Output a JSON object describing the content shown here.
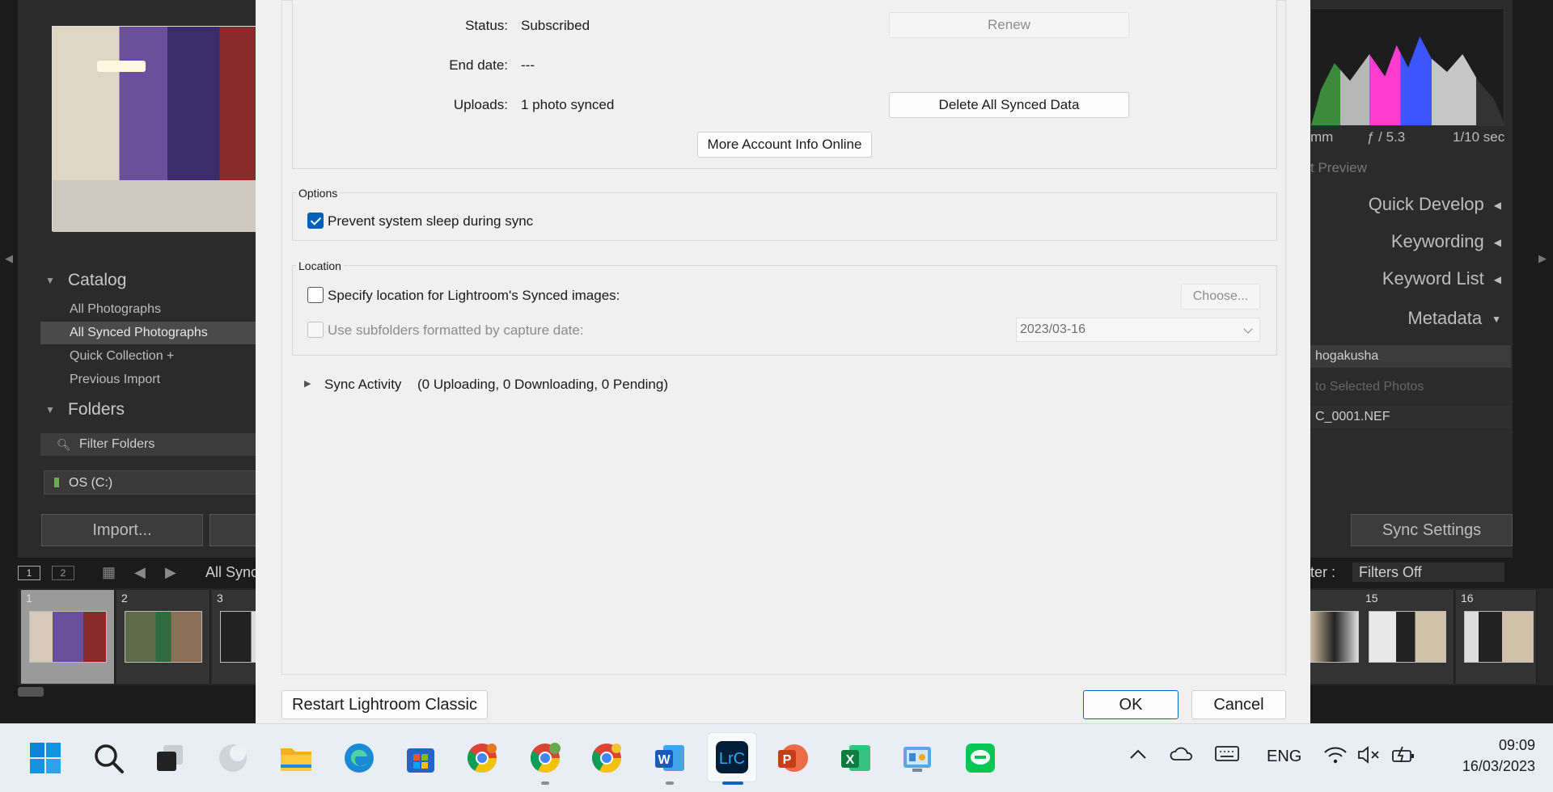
{
  "lightroom": {
    "catalog_heading": "Catalog",
    "catalog_items": [
      "All Photographs",
      "All Synced Photographs",
      "Quick Collection  +",
      "Previous Import"
    ],
    "folders_heading": "Folders",
    "filter_folders_placeholder": "Filter Folders",
    "volume": "OS (C:)",
    "import_button": "Import...",
    "exif": {
      "focal": "mm",
      "aperture": "ƒ / 5.3",
      "shutter": "1/10 sec"
    },
    "preview_label": "t Preview",
    "right_panels": [
      "Quick Develop",
      "Keywording",
      "Keyword List",
      "Metadata"
    ],
    "metadata_preset": "hogakusha",
    "metadata_target": "to      Selected Photos",
    "metadata_filename": "C_0001.NEF",
    "sync_settings_button": "Sync Settings",
    "toolbar": {
      "page1": "1",
      "page2": "2",
      "source": "All Sync",
      "filter_label": "ter :",
      "filter_value": "Filters Off"
    },
    "filmstrip": [
      {
        "num": "1"
      },
      {
        "num": "2"
      },
      {
        "num": "3"
      },
      {
        "num": "15"
      },
      {
        "num": "16"
      }
    ]
  },
  "dialog": {
    "status_label": "Status:",
    "status_value": "Subscribed",
    "renew_button": "Renew",
    "end_date_label": "End date:",
    "end_date_value": "---",
    "uploads_label": "Uploads:",
    "uploads_value": "1 photo synced",
    "delete_button": "Delete All Synced Data",
    "more_info_button": "More Account Info Online",
    "options_legend": "Options",
    "prevent_sleep": {
      "label": "Prevent system sleep during sync",
      "checked": true
    },
    "location_legend": "Location",
    "specify_location": {
      "label": "Specify location for Lightroom's Synced images:",
      "checked": false
    },
    "choose_button": "Choose...",
    "subfolders": {
      "label": "Use subfolders formatted by capture date:",
      "checked": false
    },
    "date_format": "2023/03-16",
    "sync_activity_label": "Sync Activity",
    "sync_activity_status": "(0 Uploading, 0 Downloading, 0 Pending)",
    "restart_button": "Restart Lightroom Classic",
    "ok_button": "OK",
    "cancel_button": "Cancel"
  },
  "taskbar": {
    "language": "ENG",
    "time": "09:09",
    "date": "16/03/2023",
    "apps": [
      "start",
      "search",
      "task-view",
      "widgets",
      "file-explorer",
      "edge",
      "store",
      "chrome-1",
      "chrome-2",
      "chrome-3",
      "word",
      "lightroom",
      "powerpoint",
      "excel",
      "control-panel",
      "line"
    ],
    "lightroom_label": "LrC",
    "word_label": "W",
    "powerpoint_label": "P",
    "excel_label": "X"
  }
}
